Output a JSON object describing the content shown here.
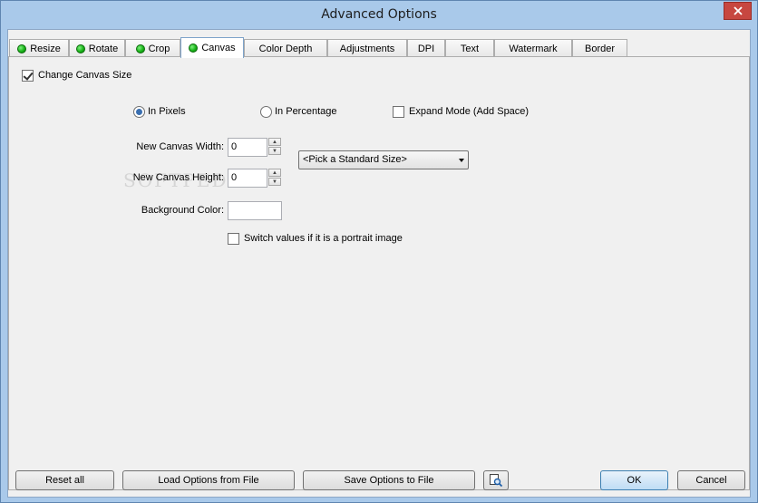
{
  "window": {
    "title": "Advanced Options"
  },
  "tabs": [
    {
      "label": "Resize",
      "has_dot": true
    },
    {
      "label": "Rotate",
      "has_dot": true
    },
    {
      "label": "Crop",
      "has_dot": true
    },
    {
      "label": "Canvas",
      "has_dot": true,
      "active": true
    },
    {
      "label": "Color Depth",
      "has_dot": false
    },
    {
      "label": "Adjustments",
      "has_dot": false
    },
    {
      "label": "DPI",
      "has_dot": false
    },
    {
      "label": "Text",
      "has_dot": false
    },
    {
      "label": "Watermark",
      "has_dot": false
    },
    {
      "label": "Border",
      "has_dot": false
    }
  ],
  "canvas": {
    "change_canvas_size": {
      "label": "Change Canvas Size",
      "checked": true
    },
    "in_pixels": {
      "label": "In Pixels",
      "selected": true
    },
    "in_percentage": {
      "label": "In Percentage",
      "selected": false
    },
    "expand_mode": {
      "label": "Expand Mode (Add Space)",
      "checked": false
    },
    "width_label": "New Canvas Width:",
    "width_value": "0",
    "height_label": "New Canvas Height:",
    "height_value": "0",
    "standard_size": "<Pick a Standard Size>",
    "background_label": "Background Color:",
    "background_value": "",
    "switch_portrait": {
      "label": "Switch values if it is a portrait image",
      "checked": false
    }
  },
  "buttons": {
    "reset_all": "Reset all",
    "load": "Load Options from File",
    "save": "Save Options to File",
    "ok": "OK",
    "cancel": "Cancel"
  },
  "watermark": "SOFTPEDIA",
  "colors": {
    "titlebar": "#a9c9ea",
    "close": "#c74740",
    "dot": "#18b418"
  }
}
